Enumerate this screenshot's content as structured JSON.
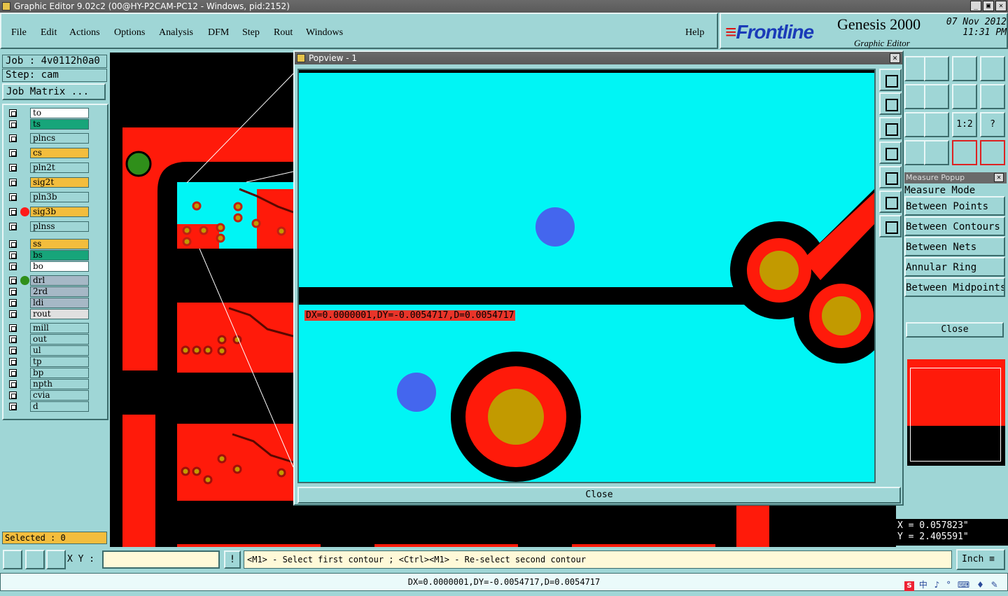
{
  "window": {
    "title": "Graphic Editor 9.02c2 (00@HY-P2CAM-PC12 - Windows, pid:2152)",
    "buttons": [
      "_",
      "▣",
      "✕"
    ]
  },
  "menu": [
    "File",
    "Edit",
    "Actions",
    "Options",
    "Analysis",
    "DFM",
    "Step",
    "Rout",
    "Windows",
    "Help"
  ],
  "brand": {
    "logo": "Frontline",
    "product": "Genesis 2000",
    "subtitle": "Graphic Editor",
    "date": "07 Nov 2012",
    "time": "11:31 PM"
  },
  "job": {
    "job_label": "Job : 4v0112h0a0",
    "step_label": "Step: cam",
    "matrix_button": "Job Matrix ..."
  },
  "layers": [
    {
      "name": "to",
      "color": "#ffffff"
    },
    {
      "name": "ts",
      "color": "#17a57a"
    },
    {
      "name": "plncs",
      "color": "#9fd6d6"
    },
    {
      "name": "cs",
      "color": "#f3bd3d"
    },
    {
      "name": "pln2t",
      "color": "#9fd6d6"
    },
    {
      "name": "sig2t",
      "color": "#f3bd3d"
    },
    {
      "name": "pln3b",
      "color": "#9fd6d6"
    },
    {
      "name": "sig3b",
      "color": "#f3bd3d",
      "dot": "#ff1a1a"
    },
    {
      "name": "plnss",
      "color": "#9fd6d6"
    },
    {
      "name": "ss",
      "color": "#f3bd3d"
    },
    {
      "name": "bs",
      "color": "#17a57a"
    },
    {
      "name": "bo",
      "color": "#ffffff"
    },
    {
      "name": "drl",
      "color": "#a6b8c6",
      "dot": "#2f8f1a"
    },
    {
      "name": "2rd",
      "color": "#a6b8c6"
    },
    {
      "name": "ldi",
      "color": "#a6b8c6"
    },
    {
      "name": "rout",
      "color": "#e0e0e0"
    },
    {
      "name": "mill",
      "color": "#9fd6d6"
    },
    {
      "name": "out",
      "color": "#9fd6d6"
    },
    {
      "name": "ul",
      "color": "#9fd6d6"
    },
    {
      "name": "tp",
      "color": "#9fd6d6"
    },
    {
      "name": "bp",
      "color": "#9fd6d6"
    },
    {
      "name": "npth",
      "color": "#9fd6d6"
    },
    {
      "name": "cvia",
      "color": "#9fd6d6"
    },
    {
      "name": "d",
      "color": "#9fd6d6"
    }
  ],
  "selected": "Selected : 0",
  "popview": {
    "title": "Popview - 1",
    "measure_readout": "DX=0.0000001,DY=-0.0054717,D=0.0054717",
    "close": "Close"
  },
  "measure_popup": {
    "title": "Measure Popup",
    "items": [
      "Measure Mode",
      "Between Points",
      "Between Contours",
      "Between Nets",
      "Annular Ring",
      "Between Midpoints"
    ],
    "close": "Close"
  },
  "coords": {
    "x": "X = 0.057823\"",
    "y": "Y = 2.405591\""
  },
  "bottom": {
    "xy_label": "X Y :",
    "xy_value": "",
    "bang": "!",
    "prompt": "<M1> - Select first contour ; <Ctrl><M1> - Re-select second contour",
    "units": "Inch"
  },
  "status": "DX=0.0000001,DY=-0.0054717,D=0.0054717",
  "tray": {
    "s_label": "S",
    "text": "中 ♪ ° ⌨ ♦ ✎"
  },
  "zoom_tool_labels": {
    "one_to_two": "1:2",
    "help": "?"
  },
  "colors": {
    "panel": "#9fd6d6",
    "board_cyan": "#00f5f5",
    "copper_red": "#ff1a0a",
    "pad_gold": "#c29a00",
    "via_blue": "#4466ee"
  }
}
